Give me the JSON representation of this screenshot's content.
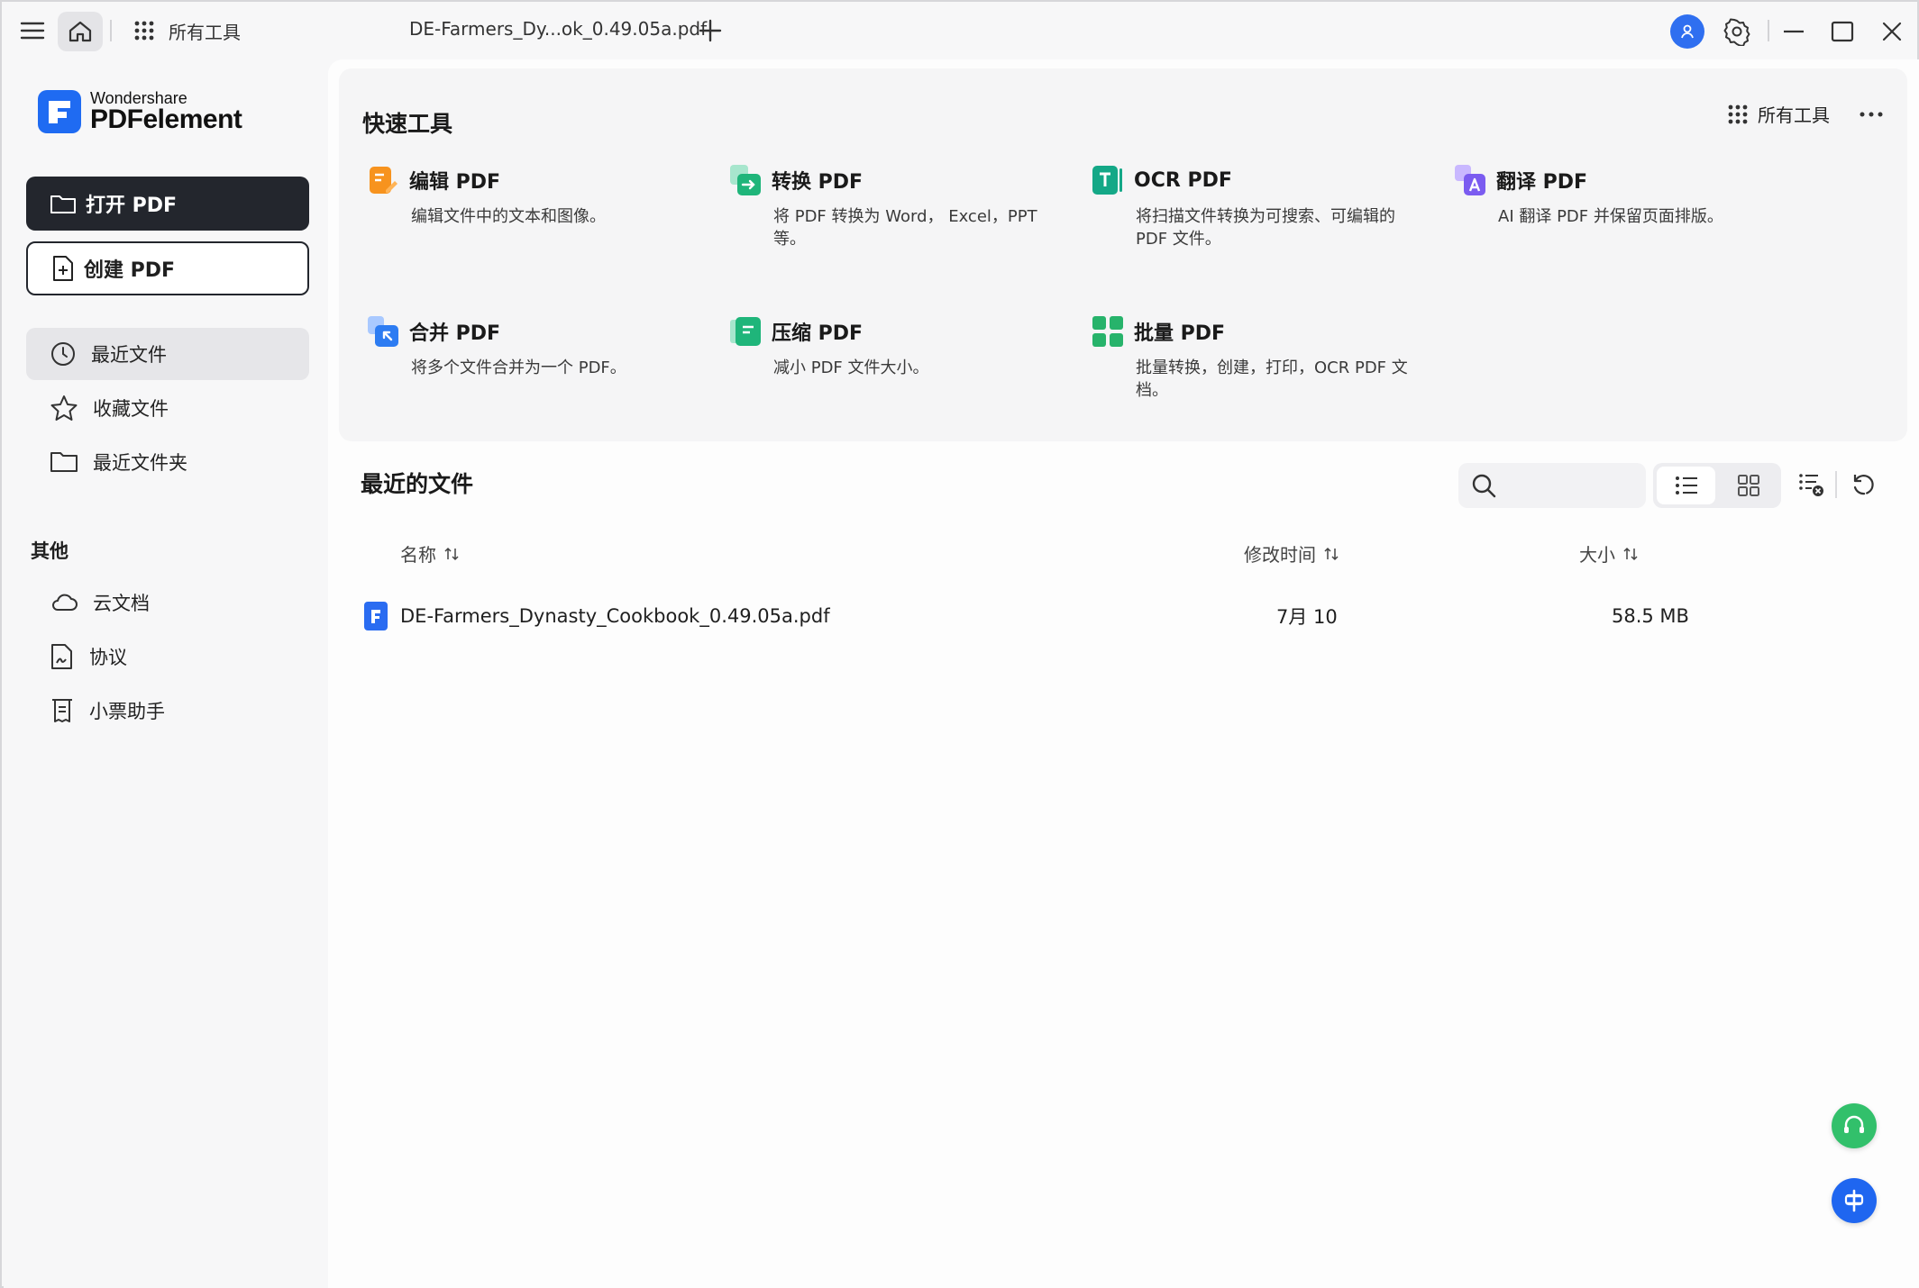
{
  "titlebar": {
    "all_tools": "所有工具",
    "tab_title": "DE-Farmers_Dy...ok_0.49.05a.pdf"
  },
  "logo": {
    "brand_small": "Wondershare",
    "brand_big": "PDFelement"
  },
  "sidebar": {
    "open_pdf": "打开 PDF",
    "create_pdf": "创建 PDF",
    "nav": [
      {
        "label": "最近文件",
        "icon": "clock-icon"
      },
      {
        "label": "收藏文件",
        "icon": "star-icon"
      },
      {
        "label": "最近文件夹",
        "icon": "folder-icon"
      }
    ],
    "other_heading": "其他",
    "other": [
      {
        "label": "云文档",
        "icon": "cloud-icon"
      },
      {
        "label": "协议",
        "icon": "agreement-icon"
      },
      {
        "label": "小票助手",
        "icon": "receipt-icon"
      }
    ]
  },
  "quick_tools": {
    "title": "快速工具",
    "all_tools": "所有工具",
    "tools": [
      {
        "name": "编辑 PDF",
        "desc": "编辑文件中的文本和图像。",
        "color": "#f7931e"
      },
      {
        "name": "转换 PDF",
        "desc": "将 PDF 转换为 Word， Excel，PPT 等。",
        "color": "#1fb57a"
      },
      {
        "name": "OCR PDF",
        "desc": "将扫描文件转换为可搜索、可编辑的 PDF 文件。",
        "color": "#14a887"
      },
      {
        "name": "翻译 PDF",
        "desc": "AI 翻译 PDF 并保留页面排版。",
        "color": "#7b5cf0"
      },
      {
        "name": "合并 PDF",
        "desc": "将多个文件合并为一个 PDF。",
        "color": "#2d7cf2"
      },
      {
        "name": "压缩 PDF",
        "desc": "减小 PDF 文件大小。",
        "color": "#1fb57a"
      },
      {
        "name": "批量 PDF",
        "desc": "批量转换，创建，打印，OCR PDF 文档。",
        "color": "#27b36b"
      }
    ]
  },
  "recent": {
    "title": "最近的文件",
    "search_placeholder": "",
    "columns": {
      "name": "名称",
      "modified": "修改时间",
      "size": "大小"
    },
    "files": [
      {
        "name": "DE-Farmers_Dynasty_Cookbook_0.49.05a.pdf",
        "modified": "7月 10",
        "size": "58.5 MB"
      }
    ]
  },
  "colors": {
    "accent": "#1f6bf2",
    "dark_button": "#23262d",
    "support": "#32c06b"
  }
}
